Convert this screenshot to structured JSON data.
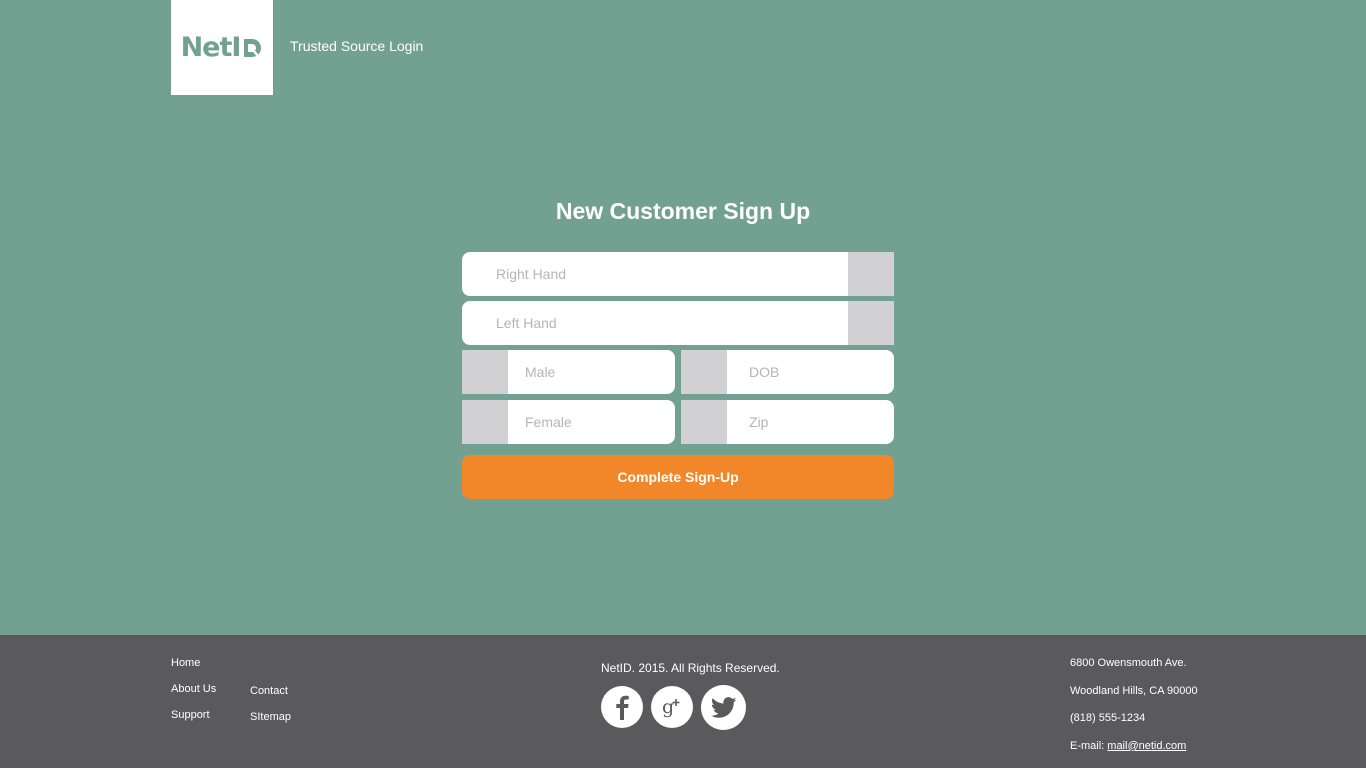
{
  "header": {
    "logo_text": "NetI",
    "link_label": "Trusted Source Login"
  },
  "form": {
    "title": "New Customer Sign Up",
    "fields": {
      "right_hand": "Right Hand",
      "left_hand": "Left Hand",
      "male": "Male",
      "dob": "DOB",
      "female": "Female",
      "zip": "Zip"
    },
    "submit_label": "Complete Sign-Up"
  },
  "footer": {
    "nav": {
      "home": "Home",
      "about": "About Us",
      "support": "Support",
      "contact": "Contact",
      "sitemap": "SItemap"
    },
    "copyright": "NetID. 2015. All Rights Reserved.",
    "social": [
      "facebook-icon",
      "google-plus-icon",
      "twitter-icon"
    ],
    "address": {
      "line1": "6800 Owensmouth Ave.",
      "line2": "Woodland Hills, CA 90000",
      "phone": "(818) 555-1234",
      "email_label": "E-mail: ",
      "email": "mail@netid.com"
    }
  },
  "colors": {
    "background": "#73a191",
    "accent": "#f2872a",
    "footer": "#5a5a5c",
    "field_side": "#d1d1d3"
  }
}
